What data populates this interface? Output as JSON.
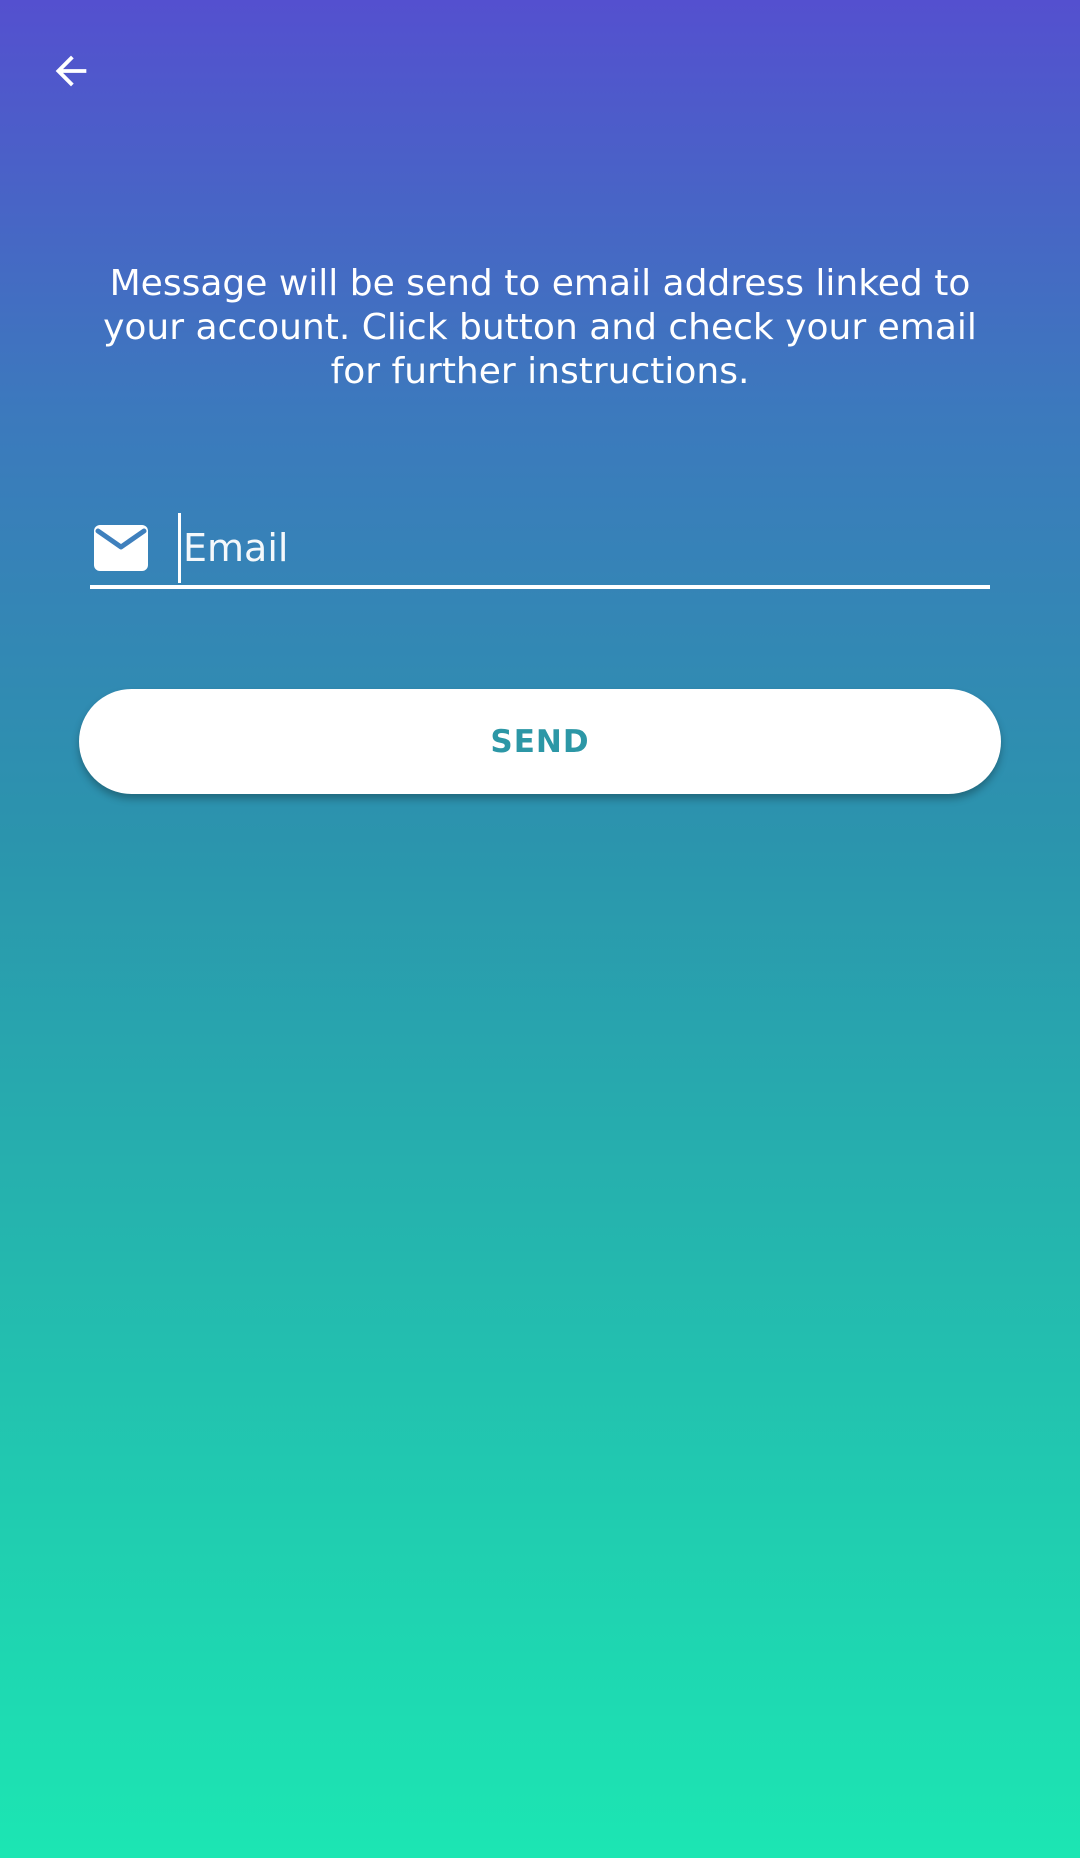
{
  "header": {
    "back_icon": "arrow-left-icon"
  },
  "main": {
    "instructions": "Message will be send to email address linked to your account. Click button and check your email for further instructions.",
    "email": {
      "icon": "mail-icon",
      "placeholder": "Email",
      "value": ""
    },
    "send_label": "SEND"
  },
  "colors": {
    "gradient_top": "#5450cf",
    "gradient_bottom": "#1ce6b3",
    "button_text": "#2c97a6",
    "foreground": "#ffffff"
  }
}
